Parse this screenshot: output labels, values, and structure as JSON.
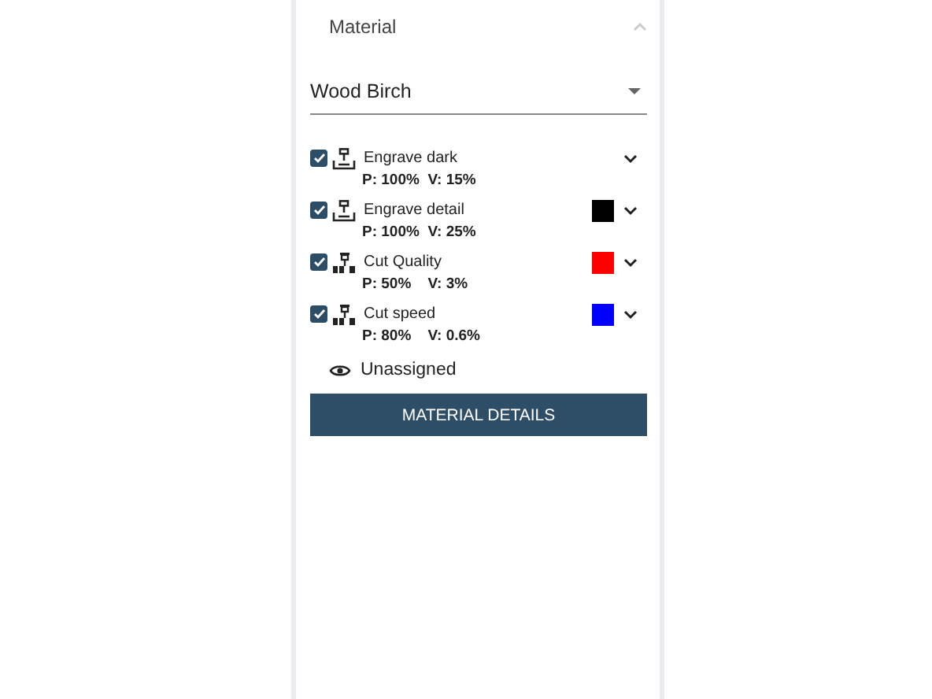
{
  "section": {
    "title": "Material",
    "expanded": true
  },
  "material_select": {
    "value": "Wood Birch"
  },
  "layers": [
    {
      "kind": "engrave",
      "name": "Engrave dark",
      "checked": true,
      "settings": "P: 100%  V: 15%"
    },
    {
      "kind": "engrave",
      "name": "Engrave detail",
      "checked": true,
      "color": "#000000",
      "settings": "P: 100%  V: 25%"
    },
    {
      "kind": "cut",
      "name": "Cut Quality",
      "checked": true,
      "color": "#ff0000",
      "settings": "P: 50%    V: 3%"
    },
    {
      "kind": "cut",
      "name": "Cut speed",
      "checked": true,
      "color": "#0000ff",
      "settings": "P: 80%    V: 0.6%"
    }
  ],
  "unassigned": "Unassigned",
  "button": "MATERIAL DETAILS"
}
